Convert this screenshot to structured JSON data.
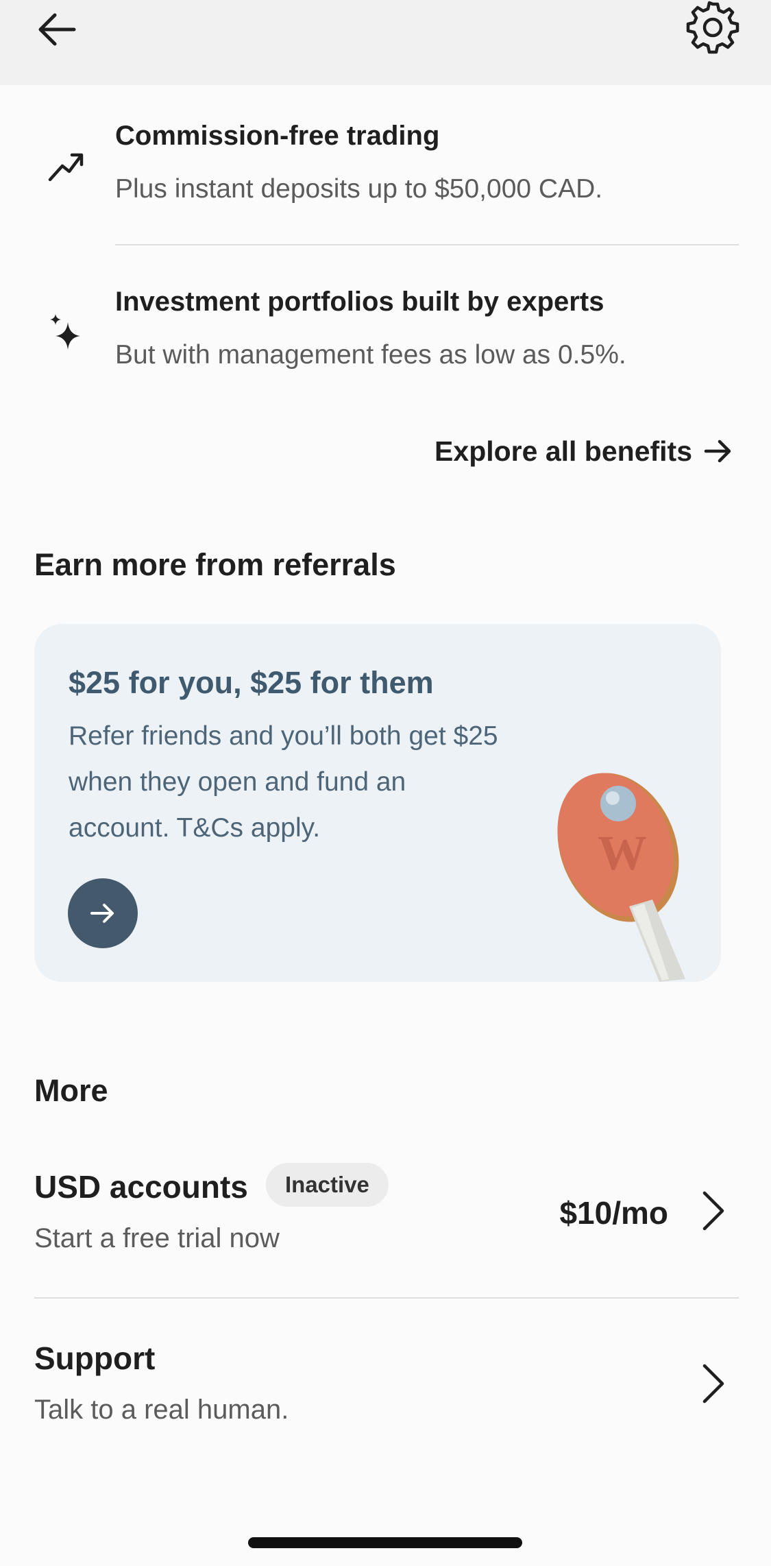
{
  "header": {
    "back_icon": "arrow-left-icon",
    "settings_icon": "gear-icon"
  },
  "benefits": [
    {
      "icon": "trending-up-icon",
      "title": "Commission-free trading",
      "subtitle": "Plus instant deposits up to $50,000 CAD."
    },
    {
      "icon": "sparkles-icon",
      "title": "Investment portfolios built by experts",
      "subtitle": "But with management fees as low as 0.5%."
    }
  ],
  "explore_link": "Explore all benefits",
  "referrals": {
    "heading": "Earn more from referrals",
    "card_title": "$25 for you, $25 for them",
    "card_body": "Refer friends and you’ll both get $25 when they open and fund an account. T&Cs apply.",
    "colors": {
      "card_bg": "#edf2f7",
      "accent": "#44596b",
      "paddle": "#e07a5f"
    }
  },
  "more": {
    "heading": "More",
    "items": [
      {
        "title": "USD accounts",
        "badge": "Inactive",
        "subtitle": "Start a free trial now",
        "price": "$10/mo"
      },
      {
        "title": "Support",
        "subtitle": "Talk to a real human."
      }
    ]
  }
}
